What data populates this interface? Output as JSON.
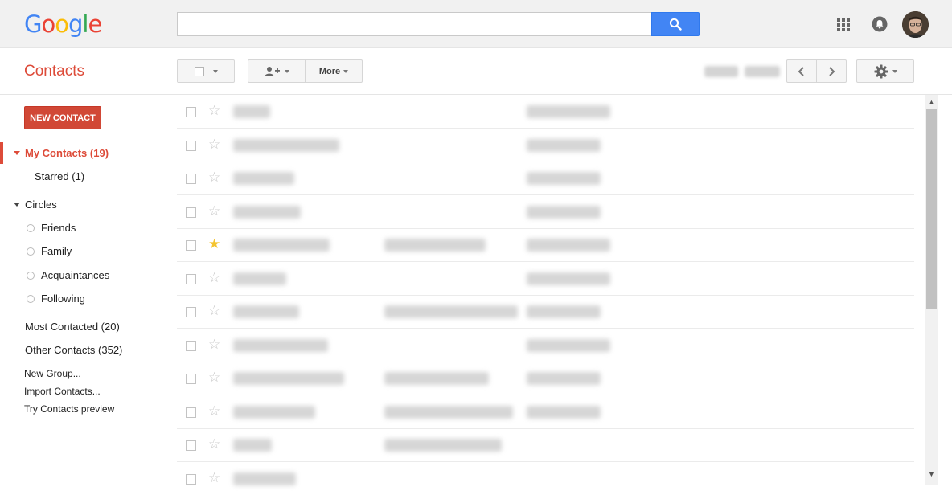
{
  "header": {
    "logo_letters": [
      {
        "ch": "G",
        "color": "#4285f4"
      },
      {
        "ch": "o",
        "color": "#ea4335"
      },
      {
        "ch": "o",
        "color": "#fbbc05"
      },
      {
        "ch": "g",
        "color": "#4285f4"
      },
      {
        "ch": "l",
        "color": "#34a853"
      },
      {
        "ch": "e",
        "color": "#ea4335"
      }
    ],
    "search_value": "",
    "search_icon": "search-icon",
    "apps_icon": "apps-grid-icon",
    "notifications_icon": "notifications-icon"
  },
  "toolbar": {
    "app_title": "Contacts",
    "more_label": "More"
  },
  "sidebar": {
    "new_contact_label": "NEW CONTACT",
    "my_contacts": "My Contacts (19)",
    "starred": "Starred (1)",
    "circles": "Circles",
    "circle_items": [
      "Friends",
      "Family",
      "Acquaintances",
      "Following"
    ],
    "most_contacted": "Most Contacted (20)",
    "other_contacts": "Other Contacts (352)",
    "new_group": "New Group...",
    "import_contacts": "Import Contacts...",
    "try_preview": "Try Contacts preview"
  },
  "contacts": [
    {
      "starred": false
    },
    {
      "starred": false
    },
    {
      "starred": false
    },
    {
      "starred": false
    },
    {
      "starred": true
    },
    {
      "starred": false
    },
    {
      "starred": false
    },
    {
      "starred": false
    },
    {
      "starred": false
    },
    {
      "starred": false
    },
    {
      "starred": false
    },
    {
      "starred": false
    }
  ],
  "colors": {
    "accent_red": "#dd4b39",
    "button_red": "#d14836",
    "search_blue": "#4285f4",
    "star_gold": "#f4c430"
  }
}
